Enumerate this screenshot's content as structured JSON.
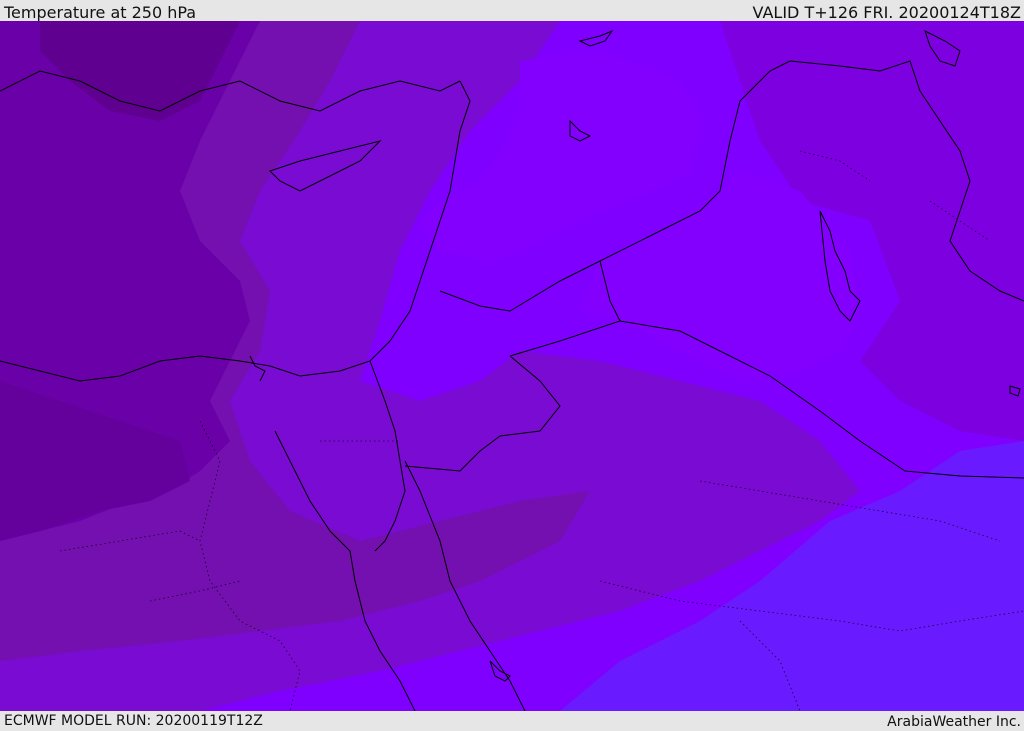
{
  "header": {
    "title": "Temperature at 250 hPa",
    "valid": "VALID T+126 FRI. 20200124T18Z"
  },
  "footer": {
    "model_run": "ECMWF MODEL RUN: 20200119T12Z",
    "credit": "ArabiaWeather Inc."
  },
  "map": {
    "colors": {
      "coldest": "#5f0090",
      "cold": "#6a00a8",
      "mid": "#7810b8",
      "warm": "#7d00e0",
      "warmer": "#8000ff",
      "warmest": "#6a1aff",
      "coastline": "#000000"
    }
  }
}
